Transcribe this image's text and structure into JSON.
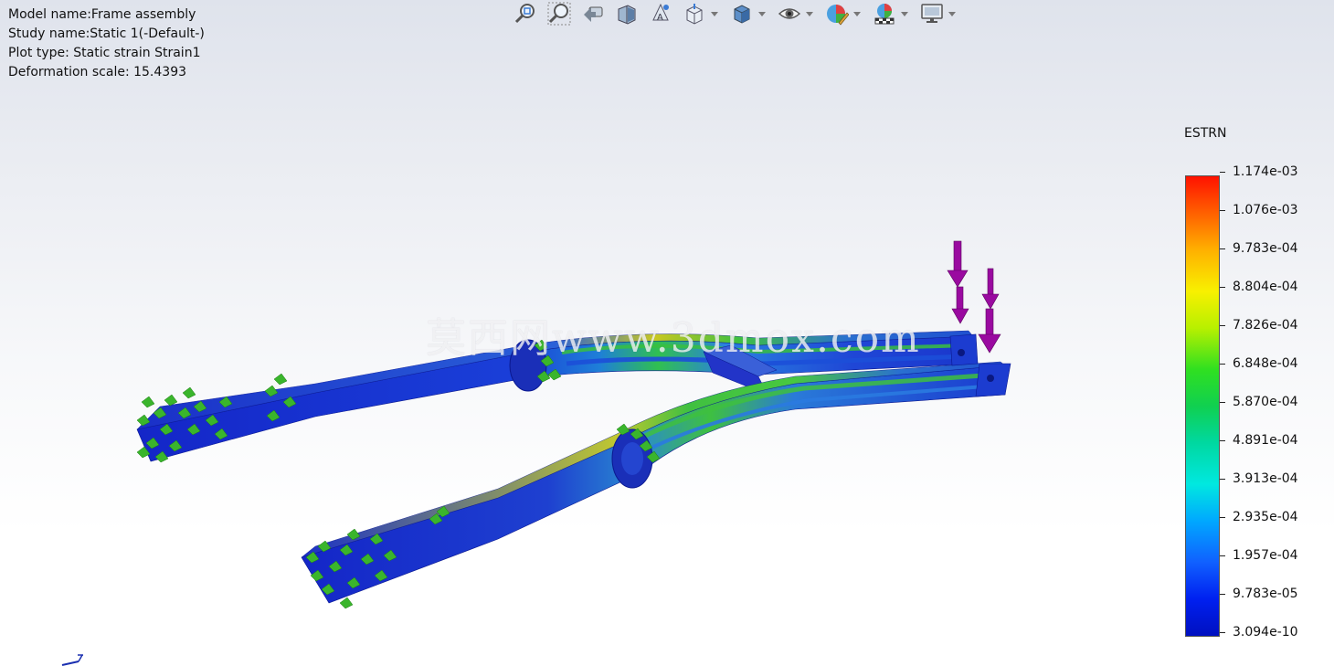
{
  "info": {
    "model_name": "Model name:Frame assembly",
    "study_name": "Study name:Static 1(-Default-)",
    "plot_type": "Plot type: Static strain Strain1",
    "deformation_scale": "Deformation scale: 15.4393"
  },
  "toolbar": {
    "tools": [
      "zoom-to-fit-icon",
      "zoom-to-area-icon",
      "previous-view-icon",
      "section-view-icon",
      "view-selector-icon",
      "view-orientation-icon",
      "display-style-icon",
      "hide-show-items-icon",
      "edit-appearance-icon",
      "apply-scene-icon",
      "view-settings-icon"
    ]
  },
  "watermark": "莫西网www.3dmox.com",
  "legend": {
    "title": "ESTRN",
    "labels": [
      "1.174e-03",
      "1.076e-03",
      "9.783e-04",
      "8.804e-04",
      "7.826e-04",
      "6.848e-04",
      "5.870e-04",
      "4.891e-04",
      "3.913e-04",
      "2.935e-04",
      "1.957e-04",
      "9.783e-05",
      "3.094e-10"
    ],
    "max_color": "#ff1200",
    "min_color": "#0010c0"
  },
  "colors": {
    "low": "#1a2fd0",
    "mid": "#20c040",
    "high": "#d0d020",
    "load_arrow": "#9a0aa0",
    "fixture": "#33b02a"
  }
}
